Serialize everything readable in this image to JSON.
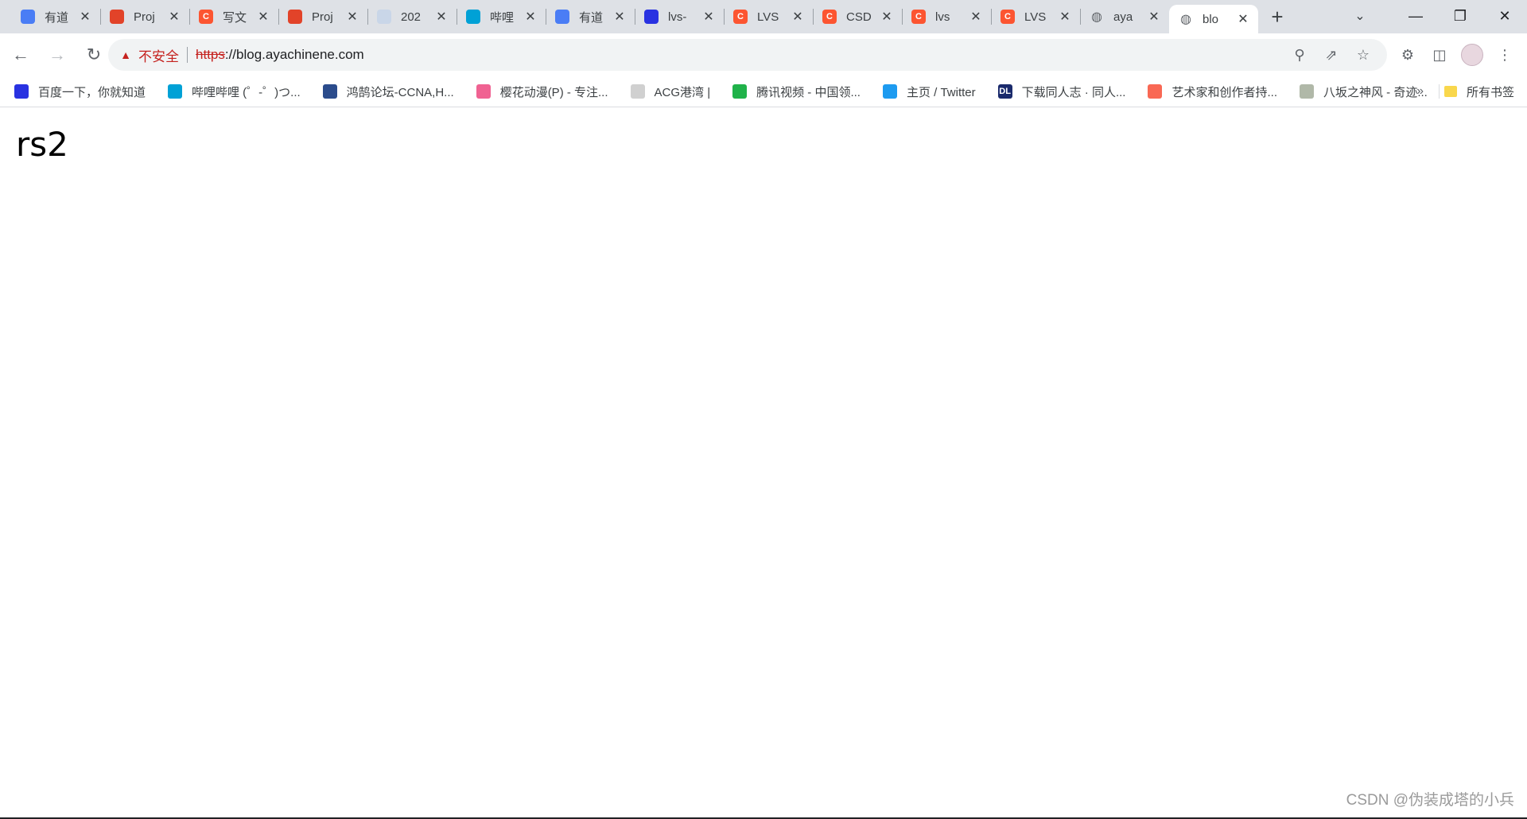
{
  "tabs": [
    {
      "title": "有道",
      "icon": "youdao-note-icon",
      "color": "#4a7df5"
    },
    {
      "title": "Proj",
      "icon": "gitlab-icon",
      "color": "#e24329"
    },
    {
      "title": "写文",
      "icon": "csdn-icon",
      "color": "#fc5531"
    },
    {
      "title": "Proj",
      "icon": "gitlab-icon",
      "color": "#e24329"
    },
    {
      "title": "202",
      "icon": "anime-avatar-icon",
      "color": "#c9d6e8"
    },
    {
      "title": "哔哩",
      "icon": "bilibili-icon",
      "color": "#00a1d6"
    },
    {
      "title": "有道",
      "icon": "youdao-note-icon",
      "color": "#4a7df5"
    },
    {
      "title": "lvs-",
      "icon": "baidu-icon",
      "color": "#2932e1"
    },
    {
      "title": "LVS",
      "icon": "csdn-icon",
      "color": "#fc5531"
    },
    {
      "title": "CSD",
      "icon": "csdn-icon",
      "color": "#fc5531"
    },
    {
      "title": "lvs",
      "icon": "csdn-icon",
      "color": "#fc5531"
    },
    {
      "title": "LVS",
      "icon": "csdn-icon",
      "color": "#fc5531"
    },
    {
      "title": "aya",
      "icon": "globe-icon",
      "color": "#5f6368"
    },
    {
      "title": "blo",
      "icon": "globe-icon",
      "color": "#5f6368",
      "active": true
    }
  ],
  "toolbar": {
    "insecure_label": "不安全",
    "url_scheme": "https",
    "url_rest": "://blog.ayachinene.com"
  },
  "bookmarks": [
    {
      "label": "百度一下，你就知道",
      "icon": "baidu-icon",
      "color": "#2932e1"
    },
    {
      "label": "哔哩哔哩 (゜-゜)つ...",
      "icon": "bilibili-icon",
      "color": "#00a1d6"
    },
    {
      "label": "鸿鹄论坛-CCNA,H...",
      "icon": "forum-icon",
      "color": "#2b4c8c"
    },
    {
      "label": "樱花动漫(P) - 专注...",
      "icon": "sakura-icon",
      "color": "#f06292"
    },
    {
      "label": "ACG港湾 |",
      "icon": "acg-icon",
      "color": "#d0d0d0"
    },
    {
      "label": "腾讯视频 - 中国领...",
      "icon": "tencent-video-icon",
      "color": "#20b24a"
    },
    {
      "label": "主页 / Twitter",
      "icon": "twitter-icon",
      "color": "#1d9bf0"
    },
    {
      "label": "下载同人志 · 同人...",
      "icon": "dl-icon",
      "color": "#1a2a6c"
    },
    {
      "label": "艺术家和创作者持...",
      "icon": "patreon-icon",
      "color": "#f96854"
    },
    {
      "label": "八坂之神风 - 奇迹...",
      "icon": "shrine-icon",
      "color": "#b0b8a8"
    }
  ],
  "bookmarks_more": "»",
  "all_bookmarks": "所有书签",
  "page": {
    "heading": "rs2"
  },
  "watermark": "CSDN @伪装成塔的小兵"
}
